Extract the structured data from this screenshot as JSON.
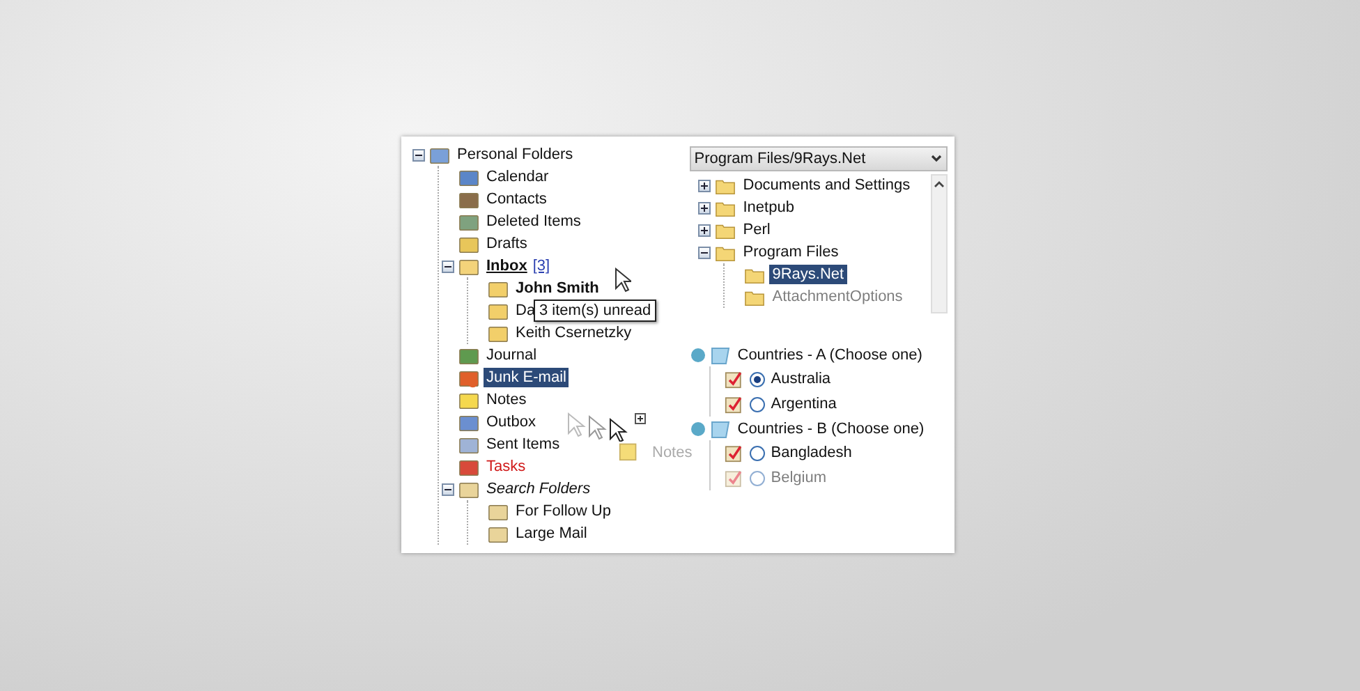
{
  "mail_tree": {
    "label": "Personal Folders",
    "kind": "personal",
    "expanded": true,
    "selected": false,
    "children": [
      {
        "label": "Calendar",
        "kind": "calendar",
        "selected": false
      },
      {
        "label": "Contacts",
        "kind": "contacts",
        "selected": false
      },
      {
        "label": "Deleted Items",
        "kind": "trash",
        "selected": false
      },
      {
        "label": "Drafts",
        "kind": "drafts",
        "selected": false
      },
      {
        "label": "Inbox",
        "count": "[3]",
        "kind": "inbox",
        "bold": true,
        "underline": true,
        "expanded": true,
        "selected": false,
        "children": [
          {
            "label": "John Smith",
            "kind": "folder",
            "bold": true,
            "selected": false
          },
          {
            "label": "Da",
            "kind": "folder",
            "selected": false
          },
          {
            "label": "Keith Csernetzky",
            "kind": "folder",
            "selected": false
          }
        ]
      },
      {
        "label": "Journal",
        "kind": "journal",
        "selected": false
      },
      {
        "label": "Junk E-mail",
        "kind": "junk",
        "selected": true
      },
      {
        "label": "Notes",
        "kind": "notes",
        "selected": false
      },
      {
        "label": "Outbox",
        "kind": "outbox",
        "selected": false
      },
      {
        "label": "Sent Items",
        "kind": "sent",
        "selected": false
      },
      {
        "label": "Tasks",
        "kind": "tasks",
        "alert": true,
        "selected": false
      },
      {
        "label": "Search Folders",
        "kind": "search",
        "italic": true,
        "expanded": true,
        "selected": false,
        "children": [
          {
            "label": "For Follow Up",
            "kind": "search",
            "selected": false
          },
          {
            "label": "Large Mail",
            "kind": "search",
            "selected": false
          }
        ]
      }
    ]
  },
  "tooltip": "3 item(s) unread",
  "drag_ghost": {
    "label": "Notes"
  },
  "path_combo": {
    "value": "Program Files/9Rays.Net"
  },
  "file_tree": [
    {
      "label": "Documents and Settings",
      "expanded": false,
      "selected": false
    },
    {
      "label": "Inetpub",
      "expanded": false,
      "selected": false
    },
    {
      "label": "Perl",
      "expanded": false,
      "selected": false
    },
    {
      "label": "Program Files",
      "expanded": true,
      "selected": false,
      "children": [
        {
          "label": "9Rays.Net",
          "selected": true
        },
        {
          "label": "AttachmentOptions",
          "selected": false,
          "faded": true
        }
      ]
    }
  ],
  "radio_groups": [
    {
      "label": "Countries - A (Choose one)",
      "options": [
        {
          "label": "Australia",
          "selected": true
        },
        {
          "label": "Argentina",
          "selected": false
        }
      ]
    },
    {
      "label": "Countries - B (Choose one)",
      "options": [
        {
          "label": "Bangladesh",
          "selected": false
        },
        {
          "label": "Belgium",
          "selected": false,
          "faded": true
        }
      ]
    }
  ]
}
